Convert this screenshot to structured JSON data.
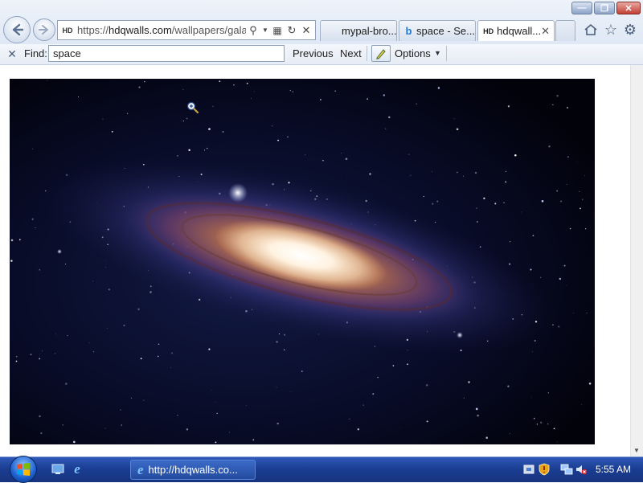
{
  "window": {
    "minimize_icon": "minimize-icon",
    "maximize_icon": "restore-icon",
    "close_icon": "close-icon"
  },
  "address_bar": {
    "site_icon_text": "HD",
    "url_prefix": "https://",
    "url_domain": "hdqwalls.com",
    "url_path": "/wallpapers/galaxy",
    "icons": [
      "search-icon",
      "dropdown-icon",
      "compatibility-icon",
      "refresh-icon",
      "stop-icon"
    ]
  },
  "tabs": [
    {
      "label": "mypal-bro...",
      "active": false,
      "icon": ""
    },
    {
      "label": "space - Se...",
      "active": false,
      "icon": "bing-icon"
    },
    {
      "label": "hdqwall...",
      "active": true,
      "icon": "hd-site-icon"
    }
  ],
  "toolbar_icons": [
    "home-icon",
    "favorites-star-icon",
    "settings-gear-icon"
  ],
  "find_bar": {
    "label": "Find:",
    "value": "space",
    "previous_label": "Previous",
    "next_label": "Next",
    "options_label": "Options"
  },
  "taskbar": {
    "task_label": "http://hdqwalls.co...",
    "clock": "5:55 AM"
  },
  "colors": {
    "taskbar": "#1b3e93",
    "galaxy_bg": "#03030f",
    "window_close": "#c24136"
  }
}
